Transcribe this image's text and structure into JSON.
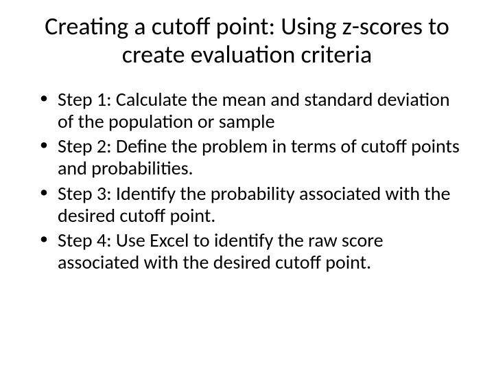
{
  "title": "Creating a cutoff point: Using z-scores to create evaluation criteria",
  "bullets": [
    "Step 1: Calculate the mean and standard deviation of the population or sample",
    "Step 2: Define the problem in terms of cutoff points and probabilities.",
    "Step 3: Identify the probability associated with the desired cutoff point.",
    "Step 4: Use Excel to identify the raw score associated with the desired cutoff point."
  ]
}
